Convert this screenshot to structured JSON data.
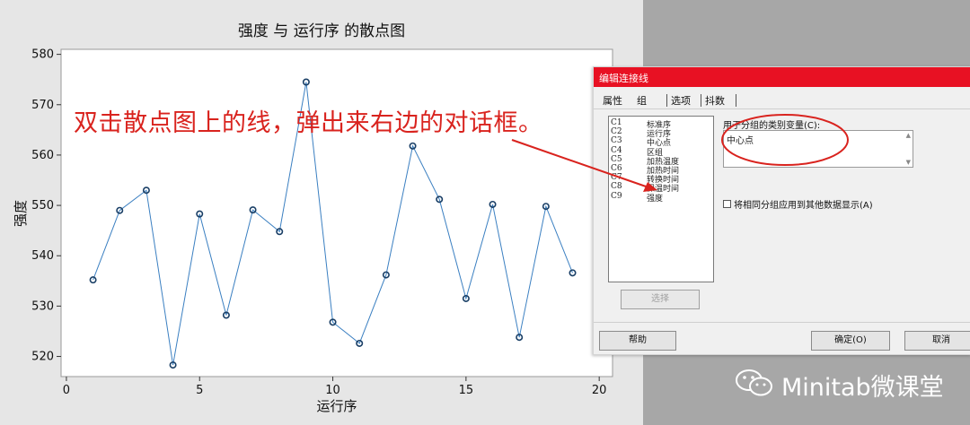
{
  "chart_data": {
    "type": "scatter",
    "title": "强度 与 运行序 的散点图",
    "xlabel": "运行序",
    "ylabel": "强度",
    "xlim": [
      -0.2,
      20.5
    ],
    "ylim": [
      516,
      581
    ],
    "xticks": [
      "0",
      "5",
      "10",
      "15",
      "20"
    ],
    "yticks": [
      "520",
      "530",
      "540",
      "550",
      "560",
      "570",
      "580"
    ],
    "connect_line": true,
    "grid": false,
    "x": [
      1,
      2,
      3,
      4,
      5,
      6,
      7,
      8,
      9,
      10,
      11,
      12,
      13,
      14,
      15,
      16,
      17,
      18,
      19
    ],
    "y": [
      535.2,
      549.0,
      553.0,
      518.3,
      548.3,
      528.2,
      549.1,
      544.8,
      574.5,
      526.8,
      522.6,
      536.2,
      561.8,
      551.2,
      531.5,
      550.2,
      523.8,
      549.8,
      536.6
    ],
    "colors": {
      "line": "#3a7fc1",
      "marker": "#1a3f66"
    }
  },
  "annotation": {
    "text": "双击散点图上的线，弹出来右边的对话框。",
    "color": "#d9231e"
  },
  "dialog": {
    "title": "编辑连接线",
    "tabs": [
      "属性",
      "组",
      "选项",
      "抖数"
    ],
    "variables": [
      {
        "id": "C1",
        "name": "标准序"
      },
      {
        "id": "C2",
        "name": "运行序"
      },
      {
        "id": "C3",
        "name": "中心点"
      },
      {
        "id": "C4",
        "name": "区组"
      },
      {
        "id": "C5",
        "name": "加热温度"
      },
      {
        "id": "C6",
        "name": "加热时间"
      },
      {
        "id": "C7",
        "name": "转换时间"
      },
      {
        "id": "C8",
        "name": "保温时间"
      },
      {
        "id": "C9",
        "name": "强度"
      }
    ],
    "select_button": "选择",
    "group_label": "用于分组的类别变量(C):",
    "group_value": "中心点",
    "checkbox_label": "将相同分组应用到其他数据显示(A)",
    "checkbox_checked": false,
    "help_button": "帮助",
    "ok_button": "确定(O)",
    "cancel_button": "取消"
  },
  "watermark": {
    "text": "Minitab微课堂",
    "icon": "wechat-icon"
  }
}
